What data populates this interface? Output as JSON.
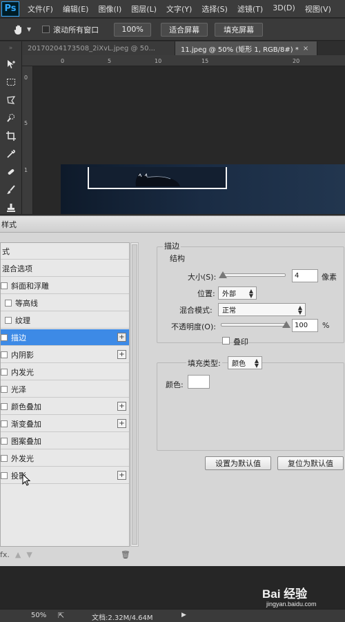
{
  "app": {
    "logo": "Ps"
  },
  "menubar": {
    "items": [
      "文件(F)",
      "编辑(E)",
      "图像(I)",
      "图层(L)",
      "文字(Y)",
      "选择(S)",
      "滤镜(T)",
      "3D(D)",
      "视图(V)"
    ]
  },
  "options_bar": {
    "tool_icon": "hand-icon",
    "scroll_all_label": "滚动所有窗口",
    "zoom_100": "100%",
    "fit_screen": "适合屏幕",
    "fill_screen": "填充屏幕"
  },
  "tabs": [
    {
      "label": "20170204173508_2iXvL.jpeg @ 50...",
      "active": false
    },
    {
      "label": "11.jpeg @ 50% (矩形 1, RGB/8#) *",
      "active": true
    }
  ],
  "rulers": {
    "h_ticks": [
      "0",
      "5",
      "10",
      "15",
      "20"
    ],
    "v_ticks": [
      "0",
      "5",
      "1"
    ]
  },
  "dialog": {
    "title": "样式",
    "styles_header": "式",
    "styles": [
      {
        "label": "混合选项",
        "checkbox": false,
        "plus": false,
        "selected": false
      },
      {
        "label": "斜面和浮雕",
        "checkbox": true,
        "plus": false,
        "selected": false
      },
      {
        "label": "等高线",
        "checkbox": true,
        "plus": false,
        "selected": false
      },
      {
        "label": "纹理",
        "checkbox": true,
        "plus": false,
        "selected": false
      },
      {
        "label": "描边",
        "checkbox": true,
        "plus": true,
        "selected": true
      },
      {
        "label": "内阴影",
        "checkbox": true,
        "plus": true,
        "selected": false
      },
      {
        "label": "内发光",
        "checkbox": true,
        "plus": false,
        "selected": false
      },
      {
        "label": "光泽",
        "checkbox": true,
        "plus": false,
        "selected": false
      },
      {
        "label": "颜色叠加",
        "checkbox": true,
        "plus": true,
        "selected": false
      },
      {
        "label": "渐变叠加",
        "checkbox": true,
        "plus": true,
        "selected": false
      },
      {
        "label": "图案叠加",
        "checkbox": true,
        "plus": false,
        "selected": false
      },
      {
        "label": "外发光",
        "checkbox": true,
        "plus": false,
        "selected": false
      },
      {
        "label": "投影",
        "checkbox": true,
        "plus": true,
        "selected": false
      }
    ],
    "footer": {
      "fx": "fx.",
      "up": "▲",
      "down": "▼",
      "trash": "🗑"
    },
    "stroke": {
      "section_title": "描边",
      "structure_title": "结构",
      "size_label": "大小(S):",
      "size_value": "4",
      "size_unit": "像素",
      "position_label": "位置:",
      "position_value": "外部",
      "blend_label": "混合模式:",
      "blend_value": "正常",
      "opacity_label": "不透明度(O):",
      "opacity_value": "100",
      "opacity_unit": "%",
      "overprint_label": "叠印",
      "fill_type_label": "填充类型:",
      "fill_type_value": "颜色",
      "color_label": "颜色:",
      "color_value": "#ffffff",
      "set_default": "设置为默认值",
      "reset_default": "复位为默认值"
    }
  },
  "status": {
    "zoom": "50%",
    "doc": "文档:2.32M/4.64M"
  },
  "watermark": {
    "brand": "Bai 经验",
    "url": "jingyan.baidu.com"
  }
}
